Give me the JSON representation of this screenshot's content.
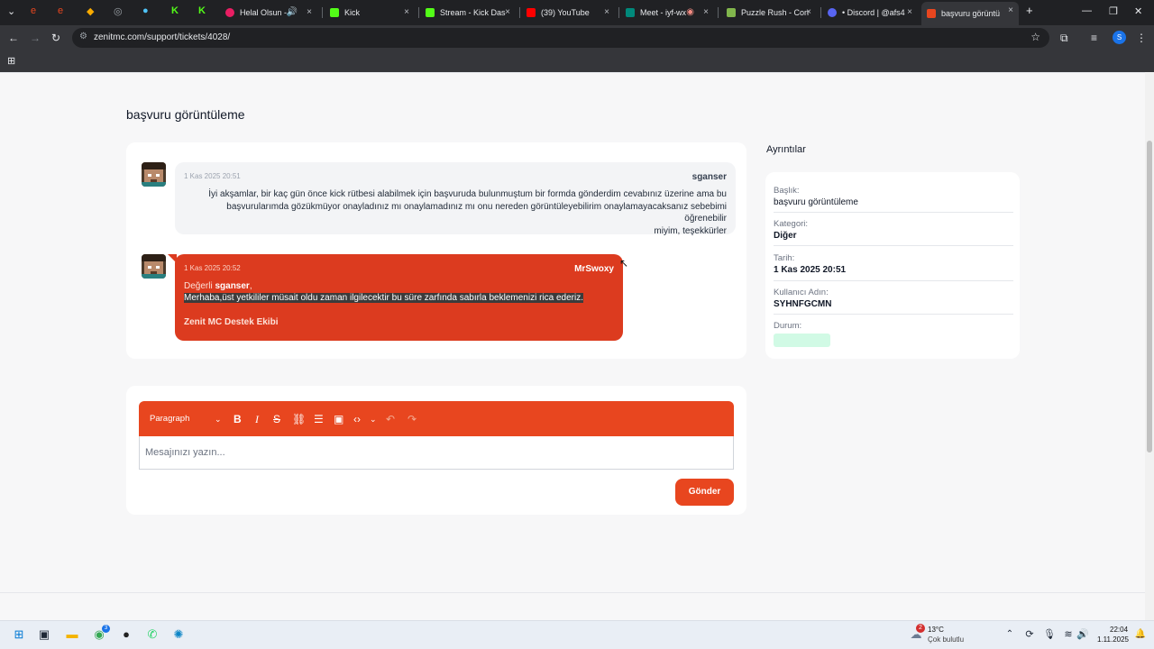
{
  "browser": {
    "tabs": [
      {
        "title": "Helal Olsun - ",
        "color": "#e91e63"
      },
      {
        "title": "Kick",
        "color": "#53fc18"
      },
      {
        "title": "Stream - Kick Das",
        "color": "#53fc18"
      },
      {
        "title": "(39) YouTube",
        "color": "#ff0000"
      },
      {
        "title": "Meet - iyf-wx",
        "color": "#00897b"
      },
      {
        "title": "Puzzle Rush - Con",
        "color": "#81b64c"
      },
      {
        "title": "• Discord | @afs4",
        "color": "#5865f2"
      },
      {
        "title": "başvuru görüntü",
        "color": "#e8461f"
      }
    ],
    "url": "zenitmc.com/support/tickets/4028/",
    "profile_initial": "S"
  },
  "page": {
    "title": "başvuru görüntüleme"
  },
  "messages": [
    {
      "time": "1 Kas 2025 20:51",
      "author": "sganser",
      "lines": [
        "İyi akşamlar, bir kaç gün önce kick rütbesi alabilmek için başvuruda bulunmuştum bir formda gönderdim cevabınız üzerine ama bu",
        "başvurularımda gözükmüyor onayladınız mı onaylamadınız mı onu nereden görüntüleyebilirim onaylamayacaksanız sebebimi öğrenebilir",
        "miyim, teşekkürler"
      ]
    },
    {
      "time": "1 Kas 2025 20:52",
      "author": "MrSwoxy",
      "greeting_prefix": "Değerli ",
      "greeting_name": "sganser",
      "greeting_suffix": ",",
      "body": "Merhaba,üst yetkililer müsait oldu zaman ilgilecektir bu süre  zarfında sabırla beklemenizi rica ederiz.",
      "signature": "Zenit MC Destek Ekibi"
    }
  ],
  "details": {
    "heading": "Ayrıntılar",
    "fields": [
      {
        "label": "Başlık:",
        "value": "başvuru görüntüleme"
      },
      {
        "label": "Kategori:",
        "value": "Diğer"
      },
      {
        "label": "Tarih:",
        "value": "1 Kas 2025 20:51"
      },
      {
        "label": "Kullanıcı Adın:",
        "value": "SYHNFGCMN"
      },
      {
        "label": "Durum:",
        "value": ""
      }
    ],
    "status_color": "#d1fae5"
  },
  "editor": {
    "block_format": "Paragraph",
    "placeholder": "Mesajınızı yazın...",
    "send_label": "Gönder",
    "accent": "#e8461f"
  },
  "taskbar": {
    "weather_temp": "13°C",
    "weather_desc": "Çok bulutlu",
    "weather_badge": "2",
    "time": "22:04",
    "date": "1.11.2025",
    "chrome_badge": "3"
  }
}
